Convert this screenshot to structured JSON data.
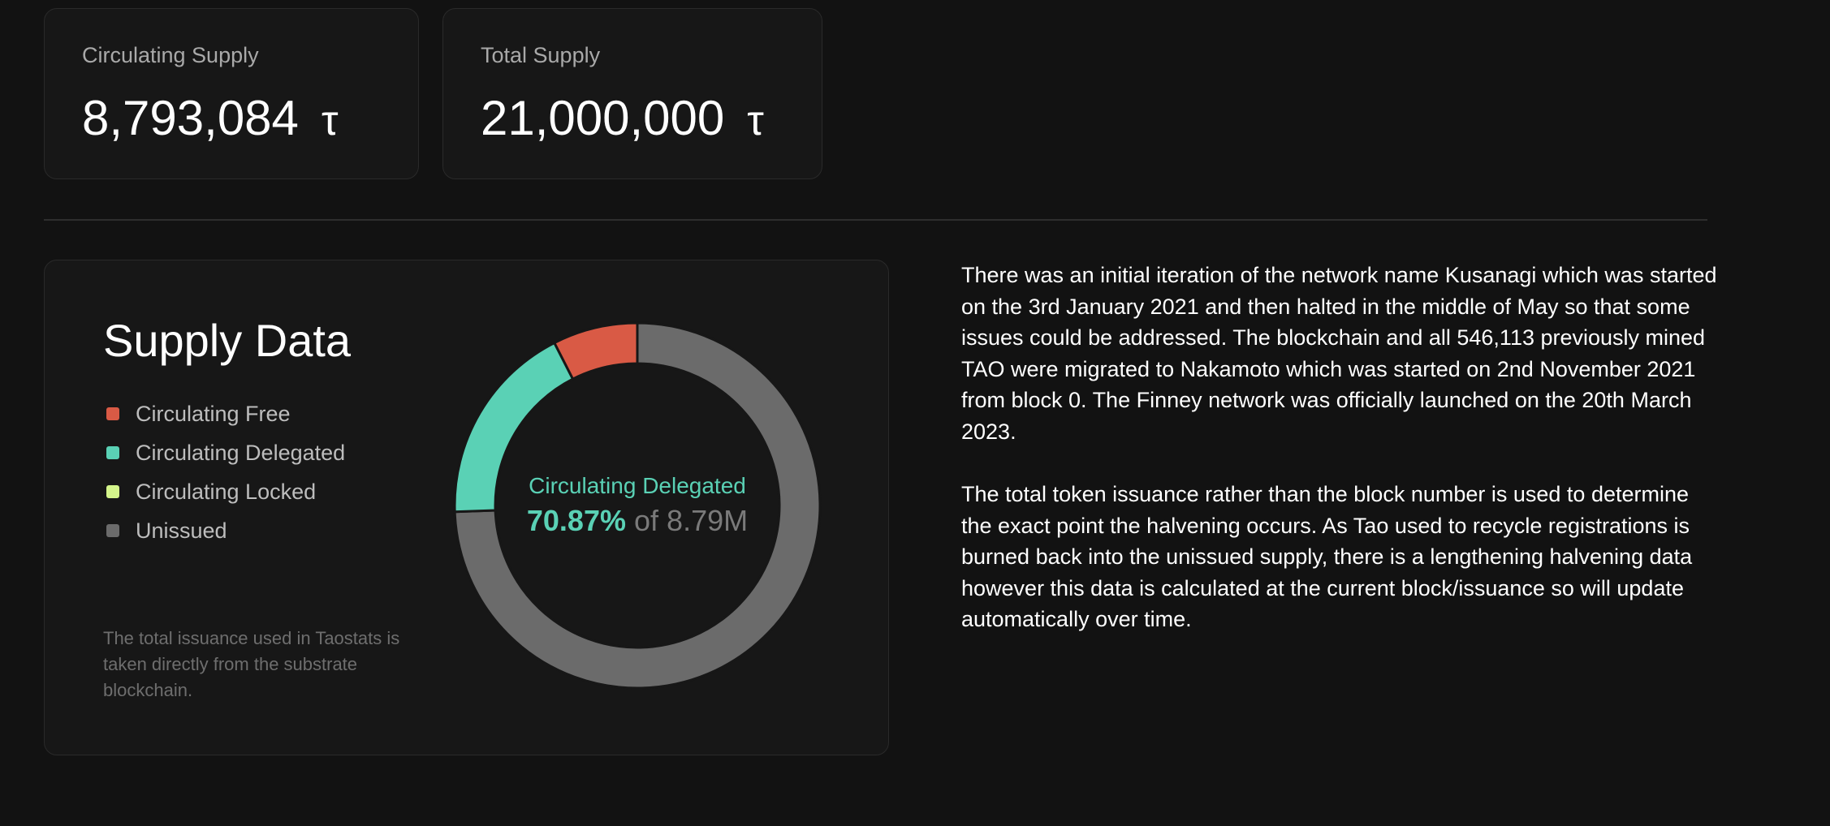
{
  "stats": {
    "circulating": {
      "label": "Circulating Supply",
      "value": "8,793,084",
      "unit": "τ"
    },
    "total": {
      "label": "Total Supply",
      "value": "21,000,000",
      "unit": "τ"
    }
  },
  "supply": {
    "title": "Supply Data",
    "legend": [
      {
        "label": "Circulating Free",
        "color": "#d95a45"
      },
      {
        "label": "Circulating Delegated",
        "color": "#5ad1b5"
      },
      {
        "label": "Circulating Locked",
        "color": "#d4f58b"
      },
      {
        "label": "Unissued",
        "color": "#6b6b6b"
      }
    ],
    "footnote": "The total issuance used in Taostats is taken directly from the substrate blockchain.",
    "center": {
      "label": "Circulating Delegated",
      "percent": "70.87%",
      "of_text": "of 8.79M"
    }
  },
  "chart_data": {
    "type": "pie",
    "title": "Supply Data",
    "donut": true,
    "slices": [
      {
        "label": "Circulating Free",
        "value": 1.23,
        "color": "#d95a45"
      },
      {
        "label": "Circulating Delegated",
        "value": 2.96,
        "color": "#5ad1b5"
      },
      {
        "label": "Circulating Locked",
        "value": 0,
        "color": "#d4f58b"
      },
      {
        "label": "Unissued",
        "value": 12.21,
        "color": "#6b6b6b"
      }
    ],
    "legend_position": "left"
  },
  "description": {
    "paragraph1": "There was an initial iteration of the network name Kusanagi which was started on the 3rd January 2021 and then halted in the middle of May so that some issues could be addressed. The blockchain and all 546,113 previously mined TAO were migrated to Nakamoto which was started on 2nd November 2021 from block 0. The Finney network was officially launched on the 20th March 2023.",
    "paragraph2": "The total token issuance rather than the block number is used to determine the exact point the halvening occurs. As Tao used to recycle registrations is burned back into the unissued supply, there is a lengthening halvening data however this data is calculated at the current block/issuance so will update automatically over time."
  }
}
